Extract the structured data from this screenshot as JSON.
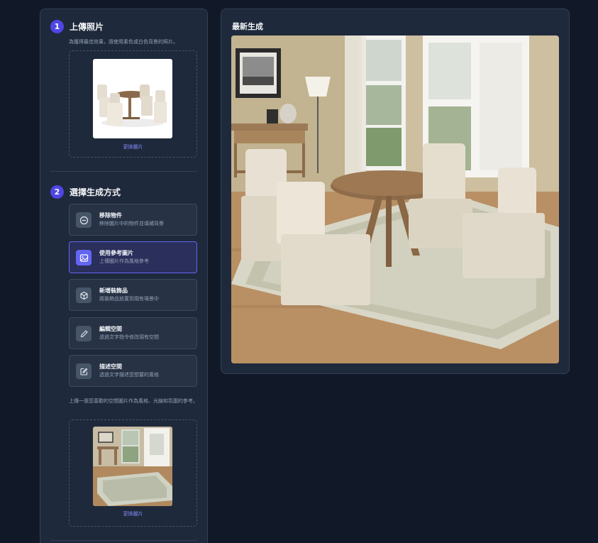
{
  "step1": {
    "number": "1",
    "title": "上傳照片",
    "hint": "為獲得最佳效果，請使用素色或白色背景的照片。",
    "change_label": "更換圖片",
    "image_icon": "product-photo-chairs-table"
  },
  "step2": {
    "number": "2",
    "title": "選擇生成方式",
    "options": [
      {
        "title": "移除物件",
        "desc": "移除圖片中的物件並填補背景",
        "icon": "minus-circle-icon",
        "selected": false
      },
      {
        "title": "使用參考圖片",
        "desc": "上傳圖片作為風格參考",
        "icon": "image-icon",
        "selected": true
      },
      {
        "title": "新增裝飾品",
        "desc": "將裝飾品放置到現有場景中",
        "icon": "cube-icon",
        "selected": false
      },
      {
        "title": "編輯空間",
        "desc": "透過文字指令修改現有空間",
        "icon": "pencil-icon",
        "selected": false
      },
      {
        "title": "描述空間",
        "desc": "透過文字描述您想要的風格",
        "icon": "edit-square-icon",
        "selected": false
      }
    ],
    "reference_hint": "上傳一張您喜歡的空間圖片作為風格、光線和氛圍的參考。",
    "change_label": "更換圖片",
    "reference_icon": "reference-room-photo"
  },
  "result": {
    "title": "最新生成",
    "image_icon": "generated-dining-room-image"
  },
  "colors": {
    "background": "#111827",
    "panel": "#1e293b",
    "accent": "#4f46e5",
    "link": "#818cf8"
  }
}
